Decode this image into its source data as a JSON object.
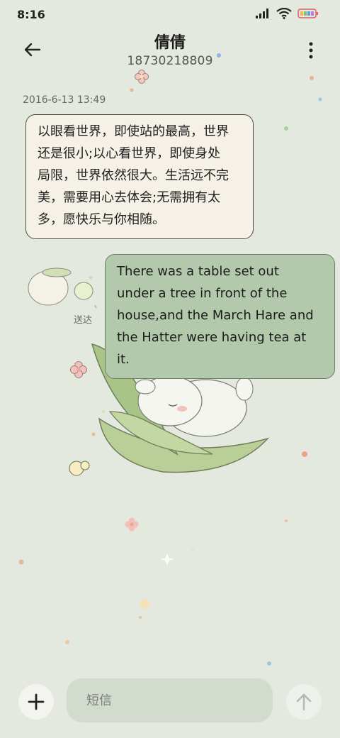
{
  "status": {
    "time": "8:16"
  },
  "header": {
    "contact_name": "倩倩",
    "contact_number": "18730218809"
  },
  "conversation": {
    "timestamp": "2016-6-13 13:49",
    "messages": [
      {
        "direction": "incoming",
        "text": "以眼看世界，即使站的最高，世界\n还是很小;以心看世界，即使身处\n局限，世界依然很大。生活远不完\n美，需要用心去体会;无需拥有太\n多，愿快乐与你相随。"
      },
      {
        "direction": "outgoing",
        "text": "There was a table set out\nunder a tree in front of the\nhouse,and the March Hare and\nthe Hatter were having tea at\nit.",
        "status": "送达"
      }
    ]
  },
  "composer": {
    "placeholder": "短信"
  },
  "colors": {
    "background": "#e3e9de",
    "incoming_bubble": "#f5f1e7",
    "outgoing_bubble": "#b3c9ac"
  }
}
